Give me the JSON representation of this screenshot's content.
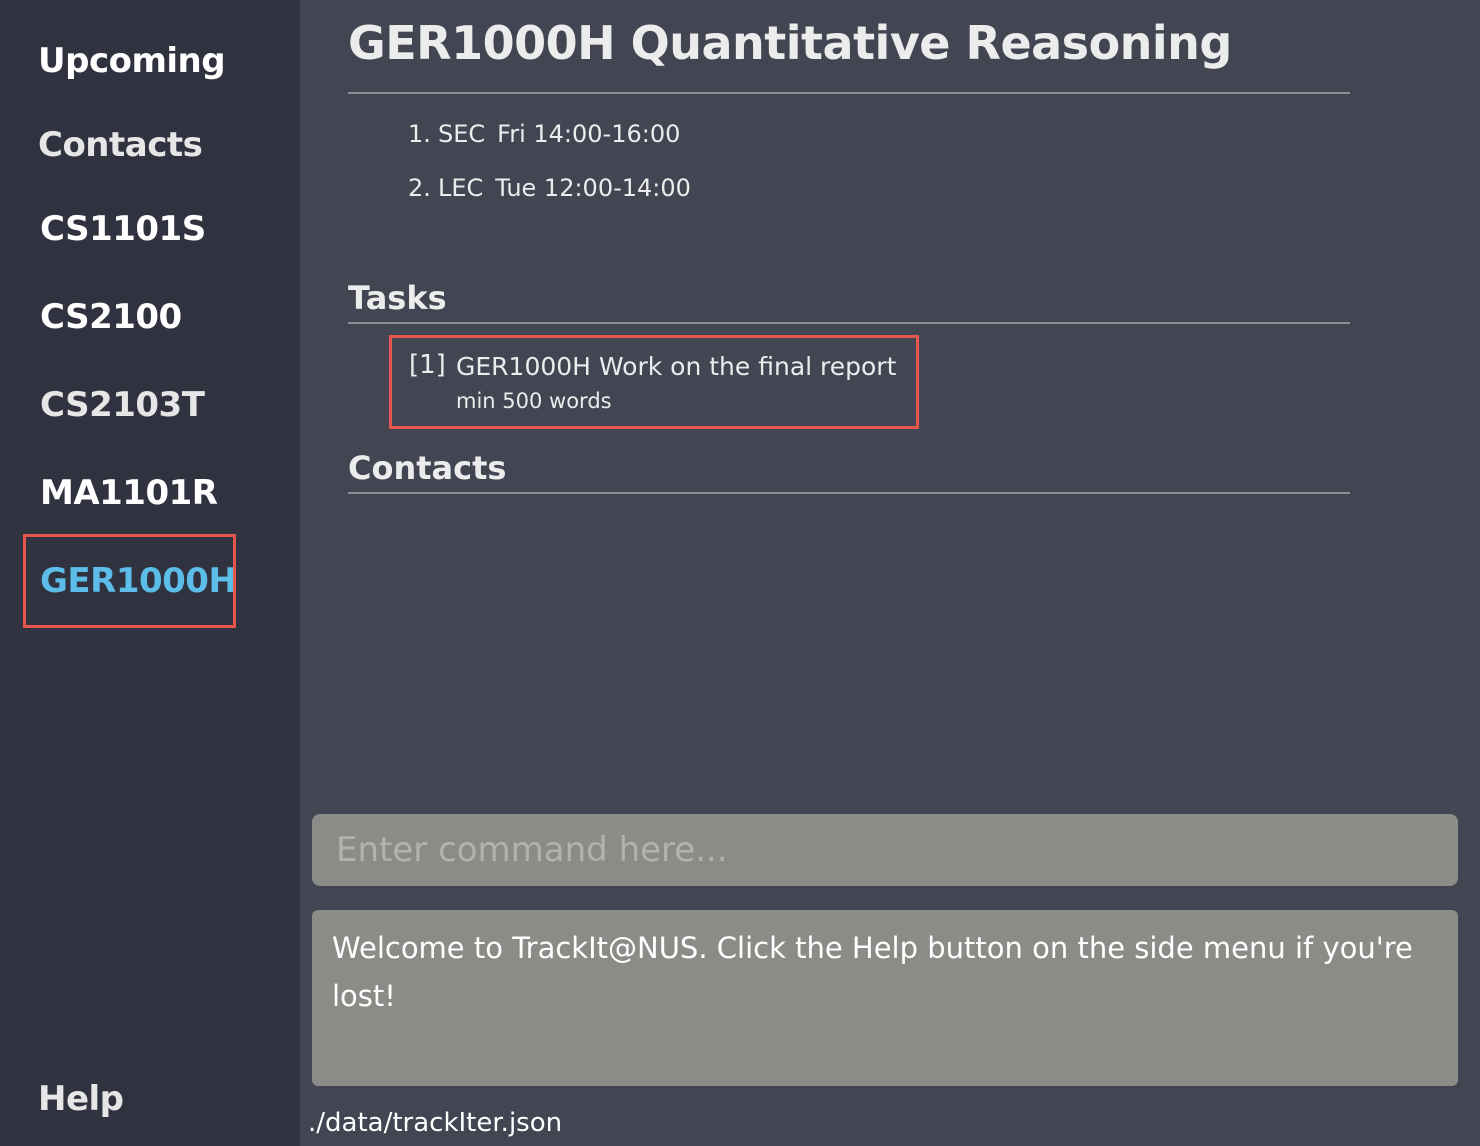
{
  "sidebar": {
    "items": [
      {
        "label": "Upcoming"
      },
      {
        "label": "Contacts"
      },
      {
        "label": "CS1101S"
      },
      {
        "label": "CS2100"
      },
      {
        "label": "CS2103T"
      },
      {
        "label": "MA1101R"
      },
      {
        "label": "GER1000H",
        "active": true
      }
    ],
    "help_label": "Help"
  },
  "module": {
    "title": "GER1000H Quantitative Reasoning",
    "lessons": [
      {
        "index": "1.",
        "type": "SEC",
        "time": "Fri 14:00-16:00"
      },
      {
        "index": "2.",
        "type": "LEC",
        "time": "Tue 12:00-14:00"
      }
    ]
  },
  "tasks": {
    "heading": "Tasks",
    "items": [
      {
        "index": "[1]",
        "title": "GER1000H Work on the final report",
        "description": "min 500 words"
      }
    ]
  },
  "contacts": {
    "heading": "Contacts"
  },
  "command": {
    "placeholder": "Enter command here..."
  },
  "result": {
    "text": "Welcome to TrackIt@NUS. Click the Help button on the side menu if you're lost!"
  },
  "status_bar": {
    "path": "./data/trackIter.json"
  },
  "colors": {
    "sidebar_bg": "#303240",
    "main_bg": "#424552",
    "active_accent": "#5bbde8",
    "highlight_border": "#e5574d",
    "input_bg": "#8b8b87"
  }
}
